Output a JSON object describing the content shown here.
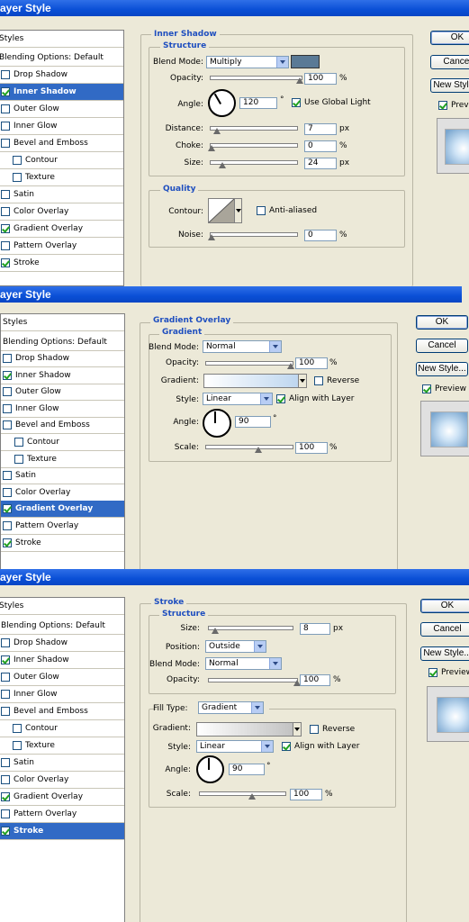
{
  "panels": [
    {
      "title": "ayer Style",
      "styles_header": "Styles",
      "blending": "Blending Options: Default",
      "items": [
        {
          "label": "Drop Shadow",
          "checked": false
        },
        {
          "label": "Inner Shadow",
          "checked": true,
          "selected": true
        },
        {
          "label": "Outer Glow",
          "checked": false
        },
        {
          "label": "Inner Glow",
          "checked": false
        },
        {
          "label": "Bevel and Emboss",
          "checked": false
        },
        {
          "label": "Contour",
          "checked": false,
          "indent": true
        },
        {
          "label": "Texture",
          "checked": false,
          "indent": true
        },
        {
          "label": "Satin",
          "checked": false
        },
        {
          "label": "Color Overlay",
          "checked": false
        },
        {
          "label": "Gradient Overlay",
          "checked": true
        },
        {
          "label": "Pattern Overlay",
          "checked": false
        },
        {
          "label": "Stroke",
          "checked": true
        }
      ],
      "section_title": "Inner Shadow",
      "structure_title": "Structure",
      "blend_mode_label": "Blend Mode:",
      "blend_mode": "Multiply",
      "shadow_color": "#5a7a96",
      "opacity_label": "Opacity:",
      "opacity": "100",
      "angle_label": "Angle:",
      "angle": "120",
      "global_light_label": "Use Global Light",
      "distance_label": "Distance:",
      "distance": "7",
      "choke_label": "Choke:",
      "choke": "0",
      "size_label": "Size:",
      "size": "24",
      "quality_title": "Quality",
      "contour_label": "Contour:",
      "anti_aliased_label": "Anti-aliased",
      "noise_label": "Noise:",
      "noise": "0",
      "pct": "%",
      "px": "px",
      "deg": "°",
      "ok": "OK",
      "cancel": "Cancel",
      "new_style": "New Style...",
      "preview": "Preview"
    },
    {
      "title": "ayer Style",
      "styles_header": "Styles",
      "blending": "Blending Options: Default",
      "items": [
        {
          "label": "Drop Shadow",
          "checked": false
        },
        {
          "label": "Inner Shadow",
          "checked": true
        },
        {
          "label": "Outer Glow",
          "checked": false
        },
        {
          "label": "Inner Glow",
          "checked": false
        },
        {
          "label": "Bevel and Emboss",
          "checked": false
        },
        {
          "label": "Contour",
          "checked": false,
          "indent": true
        },
        {
          "label": "Texture",
          "checked": false,
          "indent": true
        },
        {
          "label": "Satin",
          "checked": false
        },
        {
          "label": "Color Overlay",
          "checked": false
        },
        {
          "label": "Gradient Overlay",
          "checked": true,
          "selected": true
        },
        {
          "label": "Pattern Overlay",
          "checked": false
        },
        {
          "label": "Stroke",
          "checked": true
        }
      ],
      "section_title": "Gradient Overlay",
      "structure_title": "Gradient",
      "blend_mode_label": "Blend Mode:",
      "blend_mode": "Normal",
      "opacity_label": "Opacity:",
      "opacity": "100",
      "gradient_label": "Gradient:",
      "reverse_label": "Reverse",
      "style_label": "Style:",
      "style": "Linear",
      "align_label": "Align with Layer",
      "angle_label": "Angle:",
      "angle": "90",
      "scale_label": "Scale:",
      "scale": "100",
      "pct": "%",
      "deg": "°",
      "ok": "OK",
      "cancel": "Cancel",
      "new_style": "New Style...",
      "preview": "Preview"
    },
    {
      "title": "ayer Style",
      "styles_header": "Styles",
      "blending": "Blending Options: Default",
      "items": [
        {
          "label": "Drop Shadow",
          "checked": false
        },
        {
          "label": "Inner Shadow",
          "checked": true
        },
        {
          "label": "Outer Glow",
          "checked": false
        },
        {
          "label": "Inner Glow",
          "checked": false
        },
        {
          "label": "Bevel and Emboss",
          "checked": false
        },
        {
          "label": "Contour",
          "checked": false,
          "indent": true
        },
        {
          "label": "Texture",
          "checked": false,
          "indent": true
        },
        {
          "label": "Satin",
          "checked": false
        },
        {
          "label": "Color Overlay",
          "checked": false
        },
        {
          "label": "Gradient Overlay",
          "checked": true
        },
        {
          "label": "Pattern Overlay",
          "checked": false
        },
        {
          "label": "Stroke",
          "checked": true,
          "selected": true
        }
      ],
      "section_title": "Stroke",
      "structure_title": "Structure",
      "size_label": "Size:",
      "size": "8",
      "position_label": "Position:",
      "position": "Outside",
      "blend_mode_label": "Blend Mode:",
      "blend_mode": "Normal",
      "opacity_label": "Opacity:",
      "opacity": "100",
      "fill_type_label": "Fill Type:",
      "fill_type": "Gradient",
      "gradient_label": "Gradient:",
      "reverse_label": "Reverse",
      "style_label": "Style:",
      "style": "Linear",
      "align_label": "Align with Layer",
      "angle_label": "Angle:",
      "angle": "90",
      "scale_label": "Scale:",
      "scale": "100",
      "pct": "%",
      "px": "px",
      "deg": "°",
      "ok": "OK",
      "cancel": "Cancel",
      "new_style": "New Style...",
      "preview": "Preview"
    }
  ]
}
